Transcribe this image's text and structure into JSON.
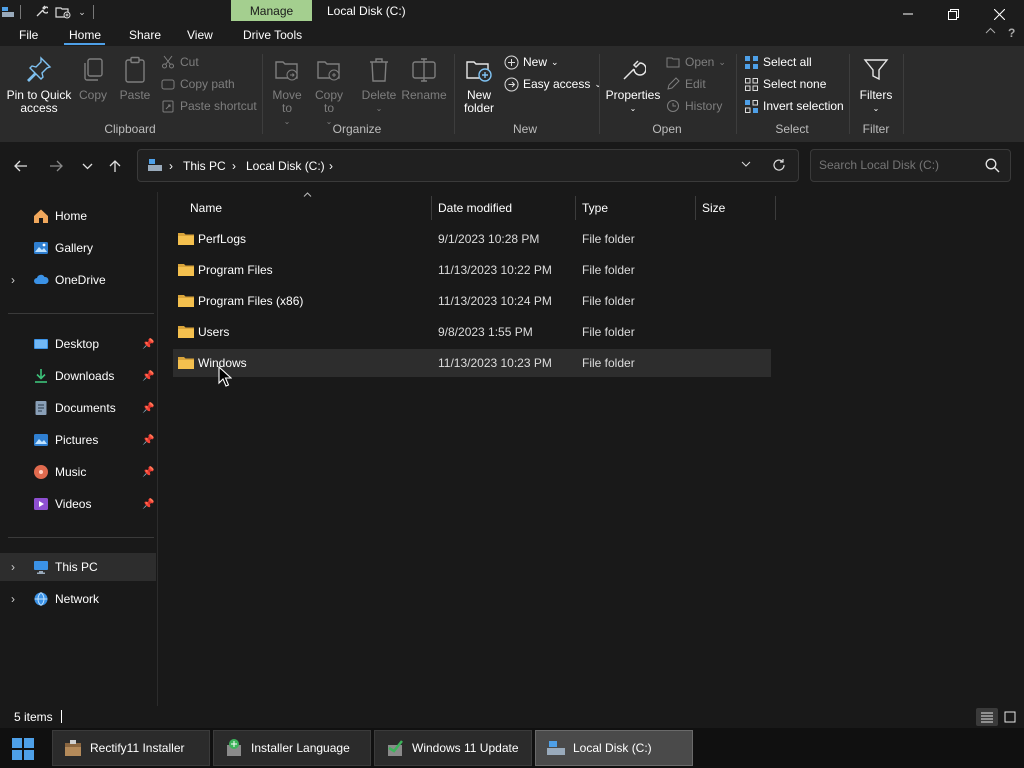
{
  "titlebar": {
    "contextual_tab": "Manage",
    "title": "Local Disk (C:)"
  },
  "tabs": [
    "File",
    "Home",
    "Share",
    "View",
    "Drive Tools"
  ],
  "ribbon": {
    "clipboard": {
      "pin": "Pin to Quick access",
      "copy": "Copy",
      "paste": "Paste",
      "cut": "Cut",
      "copy_path": "Copy path",
      "paste_shortcut": "Paste shortcut",
      "label": "Clipboard"
    },
    "organize": {
      "move_to": "Move to",
      "copy_to": "Copy to",
      "delete": "Delete",
      "rename": "Rename",
      "label": "Organize"
    },
    "new": {
      "new_folder": "New folder",
      "new_item": "New",
      "easy_access": "Easy access",
      "label": "New"
    },
    "open": {
      "properties": "Properties",
      "open": "Open",
      "edit": "Edit",
      "history": "History",
      "label": "Open"
    },
    "select": {
      "select_all": "Select all",
      "select_none": "Select none",
      "invert": "Invert selection",
      "label": "Select"
    },
    "filter": {
      "filters": "Filters",
      "label": "Filter"
    }
  },
  "address": {
    "crumbs": [
      "This PC",
      "Local Disk (C:)"
    ],
    "search_placeholder": "Search Local Disk (C:)"
  },
  "navpane": {
    "top": [
      {
        "label": "Home"
      },
      {
        "label": "Gallery"
      },
      {
        "label": "OneDrive"
      }
    ],
    "quick": [
      {
        "label": "Desktop"
      },
      {
        "label": "Downloads"
      },
      {
        "label": "Documents"
      },
      {
        "label": "Pictures"
      },
      {
        "label": "Music"
      },
      {
        "label": "Videos"
      }
    ],
    "bottom": [
      {
        "label": "This PC"
      },
      {
        "label": "Network"
      }
    ]
  },
  "filelist": {
    "columns": [
      "Name",
      "Date modified",
      "Type",
      "Size"
    ],
    "rows": [
      {
        "name": "PerfLogs",
        "date": "9/1/2023 10:28 PM",
        "type": "File folder"
      },
      {
        "name": "Program Files",
        "date": "11/13/2023 10:22 PM",
        "type": "File folder"
      },
      {
        "name": "Program Files (x86)",
        "date": "11/13/2023 10:24 PM",
        "type": "File folder"
      },
      {
        "name": "Users",
        "date": "9/8/2023 1:55 PM",
        "type": "File folder"
      },
      {
        "name": "Windows",
        "date": "11/13/2023 10:23 PM",
        "type": "File folder"
      }
    ]
  },
  "status": {
    "count": "5 items"
  },
  "taskbar": [
    {
      "label": "Rectify11 Installer"
    },
    {
      "label": "Installer Language"
    },
    {
      "label": "Windows 11 Update"
    },
    {
      "label": "Local Disk (C:)"
    }
  ],
  "colors": {
    "accent": "#4ea0e8",
    "manage_tab": "#a4cf8f",
    "folder": "#f4c04e"
  }
}
